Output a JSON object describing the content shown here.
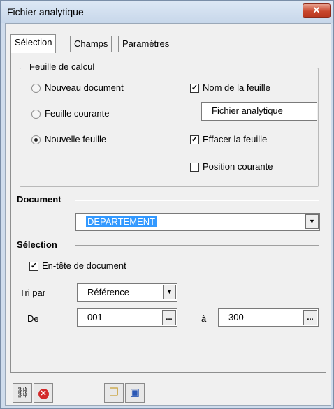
{
  "window": {
    "title": "Fichier analytique",
    "close_label": "✕"
  },
  "tabs": [
    "Sélection",
    "Champs",
    "Paramètres"
  ],
  "group": {
    "legend": "Feuille de calcul",
    "radios": [
      {
        "label": "Nouveau document",
        "selected": false
      },
      {
        "label": "Feuille courante",
        "selected": false
      },
      {
        "label": "Nouvelle feuille",
        "selected": true
      }
    ],
    "checks": [
      {
        "label": "Nom de la feuille",
        "checked": true
      },
      {
        "label": "Effacer la feuille",
        "checked": true
      },
      {
        "label": "Position courante",
        "checked": false
      }
    ],
    "sheet_name": "Fichier analytique"
  },
  "document": {
    "heading": "Document",
    "value": "DEPARTEMENT"
  },
  "selection": {
    "heading": "Sélection",
    "header_check": {
      "label": "En-tête de document",
      "checked": true
    },
    "sort_label": "Tri par",
    "sort_value": "Référence",
    "from_label": "De",
    "from_value": "001",
    "to_label": "à",
    "to_value": "300"
  },
  "toolbar": {
    "ellipsis": "..."
  }
}
